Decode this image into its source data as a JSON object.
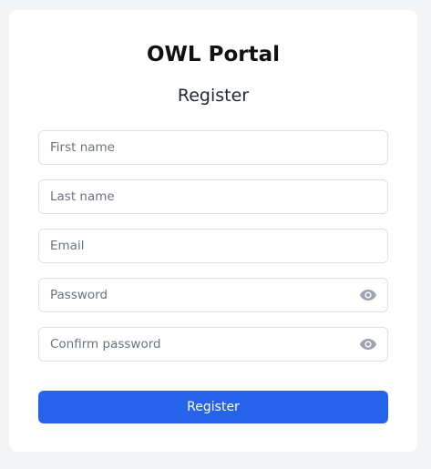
{
  "header": {
    "app_title": "OWL Portal",
    "subtitle": "Register"
  },
  "form": {
    "first_name": {
      "value": "",
      "placeholder": "First name"
    },
    "last_name": {
      "value": "",
      "placeholder": "Last name"
    },
    "email": {
      "value": "",
      "placeholder": "Email"
    },
    "password": {
      "value": "",
      "placeholder": "Password",
      "toggle_icon": "eye-icon"
    },
    "confirm_password": {
      "value": "",
      "placeholder": "Confirm password",
      "toggle_icon": "eye-icon"
    },
    "submit_label": "Register"
  },
  "colors": {
    "background": "#f3f4f6",
    "card": "#ffffff",
    "primary": "#2563eb",
    "input_border": "#dde1e6",
    "icon": "#9ca3af"
  }
}
